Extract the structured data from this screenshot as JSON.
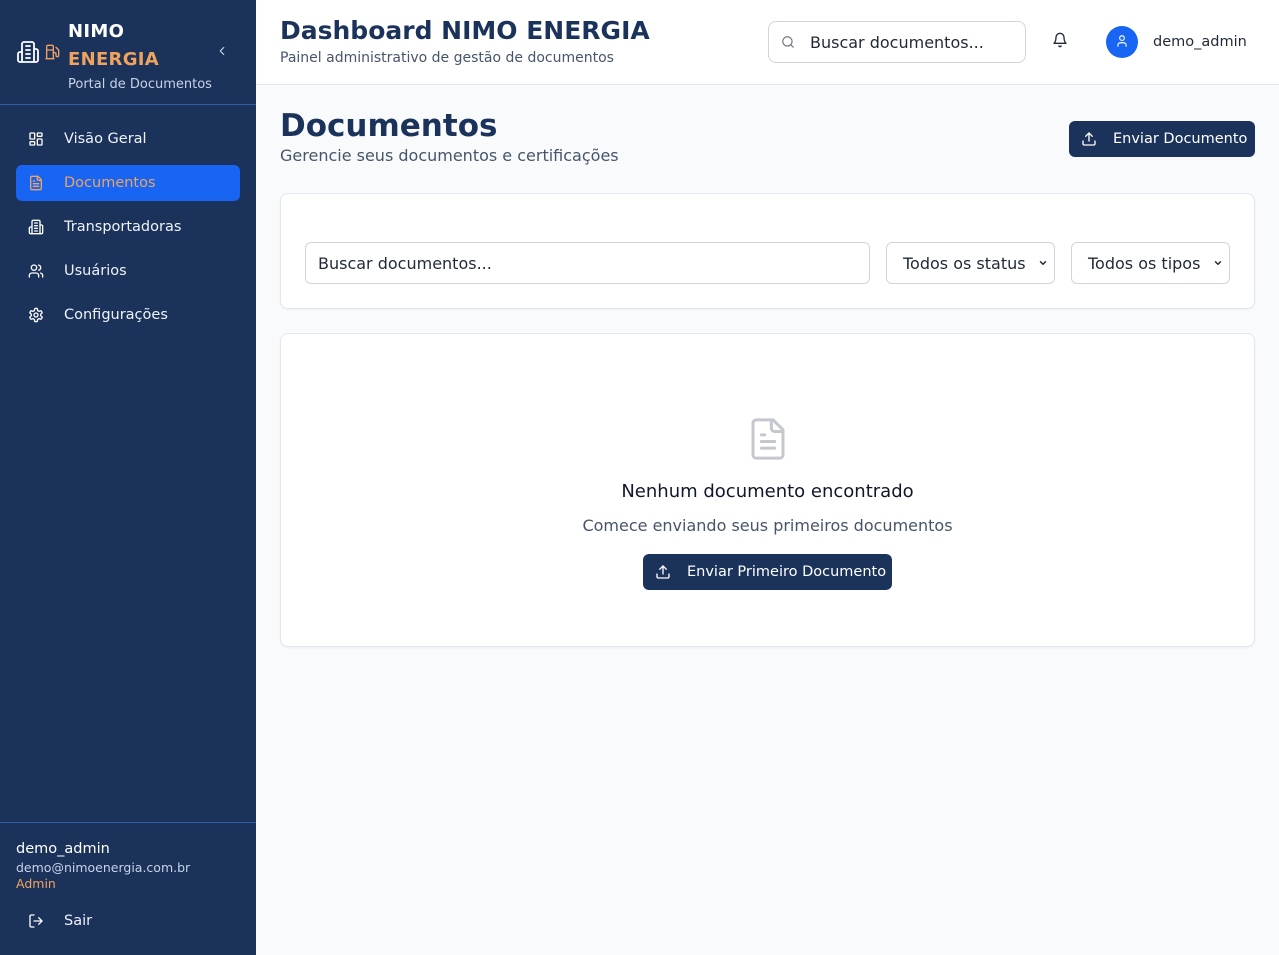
{
  "colors": {
    "sidebar_bg": "#1b335a",
    "accent_orange": "#f0a35e",
    "active_blue": "#1765f2",
    "primary_button": "#1b335a"
  },
  "sidebar": {
    "brand": {
      "name_line1": "NIMO",
      "name_line2": "ENERGIA",
      "subtitle": "Portal de Documentos",
      "icons": [
        "building-icon",
        "fuel-pump-icon"
      ]
    },
    "collapse_icon": "chevron-left-icon",
    "items": [
      {
        "label": "Visão Geral",
        "icon": "layout-grid-icon",
        "active": false
      },
      {
        "label": "Documentos",
        "icon": "file-text-icon",
        "active": true
      },
      {
        "label": "Transportadoras",
        "icon": "building-icon",
        "active": false
      },
      {
        "label": "Usuários",
        "icon": "users-icon",
        "active": false
      },
      {
        "label": "Configurações",
        "icon": "gear-icon",
        "active": false
      }
    ],
    "user": {
      "name": "demo_admin",
      "email": "demo@nimoenergia.com.br",
      "role": "Admin"
    },
    "logout_label": "Sair"
  },
  "header": {
    "title": "Dashboard NIMO ENERGIA",
    "subtitle": "Painel administrativo de gestão de documentos",
    "search_placeholder": "Buscar documentos...",
    "username": "demo_admin"
  },
  "main": {
    "title": "Documentos",
    "subtitle": "Gerencie seus documentos e certificações",
    "upload_button": "Enviar Documento",
    "filters": {
      "search_placeholder": "Buscar documentos...",
      "status_selected": "Todos os status",
      "type_selected": "Todos os tipos"
    },
    "empty_state": {
      "title": "Nenhum documento encontrado",
      "subtitle": "Comece enviando seus primeiros documentos",
      "button": "Enviar Primeiro Documento"
    }
  }
}
